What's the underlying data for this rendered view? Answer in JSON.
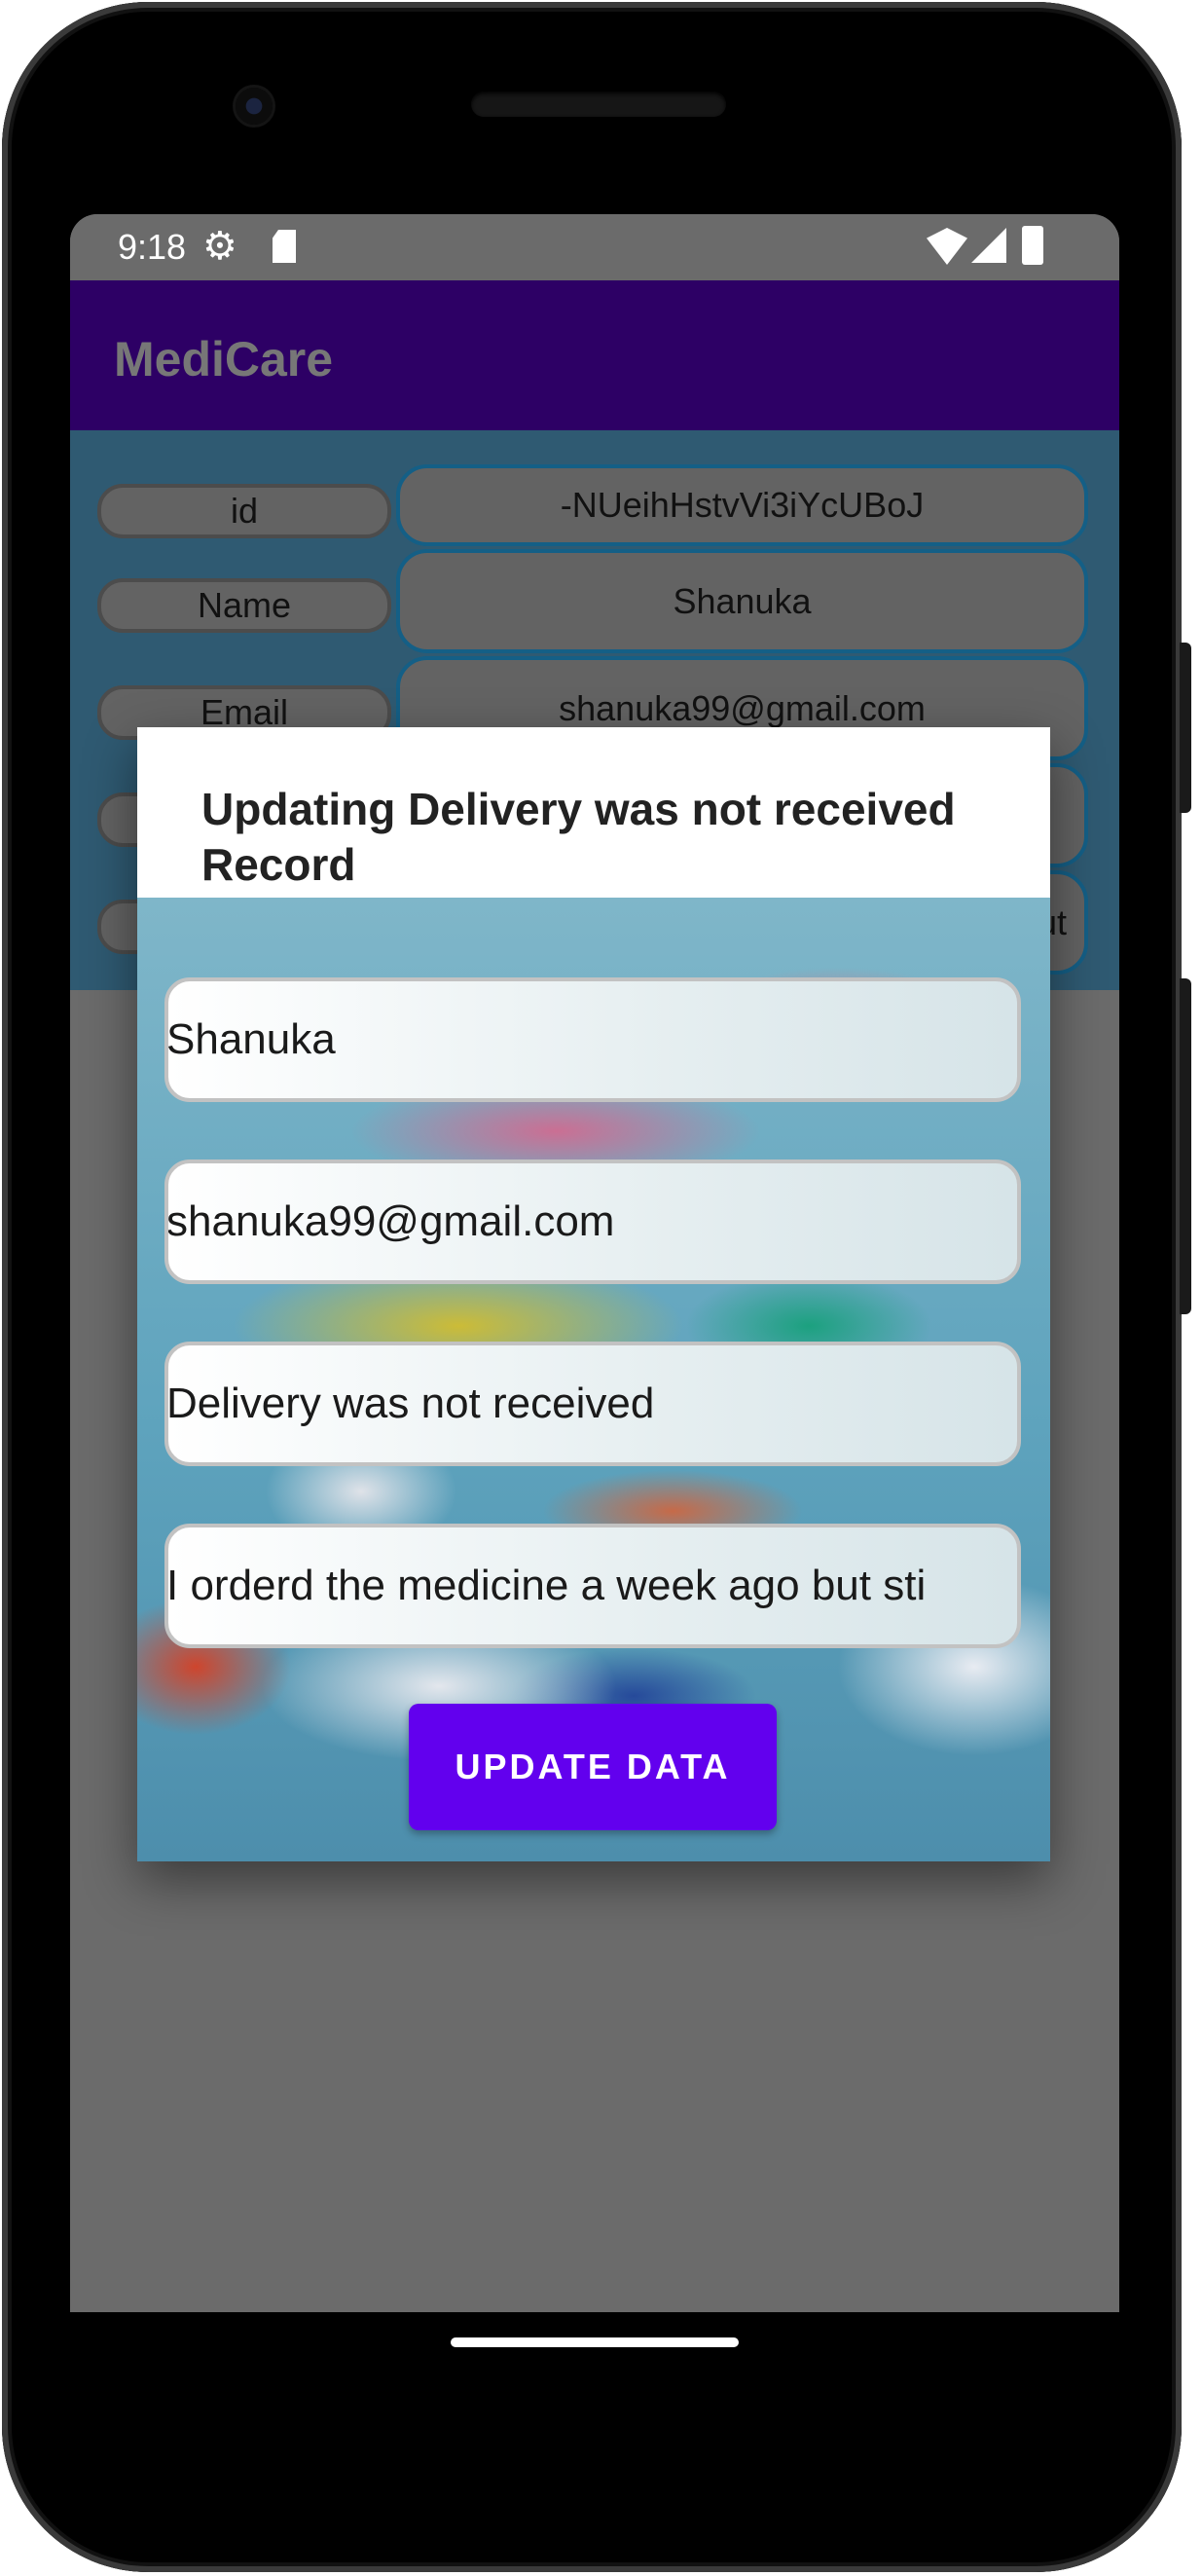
{
  "status_bar": {
    "time": "9:18",
    "icons": [
      "settings-gear-icon",
      "sd-card-icon",
      "wifi-icon",
      "cell-signal-icon",
      "battery-icon"
    ]
  },
  "app_bar": {
    "title": "MediCare"
  },
  "background_rows": [
    {
      "label": "id",
      "value": "-NUeihHstvVi3iYcUBoJ"
    },
    {
      "label": "Name",
      "value": "Shanuka"
    },
    {
      "label": "Email",
      "value": "shanuka99@gmail.com"
    },
    {
      "label": "",
      "value": ""
    },
    {
      "label": "",
      "value": "ut"
    }
  ],
  "dialog": {
    "title": "Updating Delivery was not received Record",
    "fields": {
      "name": "Shanuka",
      "email": "shanuka99@gmail.com",
      "subject": "Delivery was not received",
      "message": "I orderd the medicine a week ago but sti"
    },
    "button_label": "UPDATE DATA"
  },
  "colors": {
    "app_bar": "#2d0065",
    "button": "#6200ee",
    "scrim": "#6b6b6b"
  }
}
